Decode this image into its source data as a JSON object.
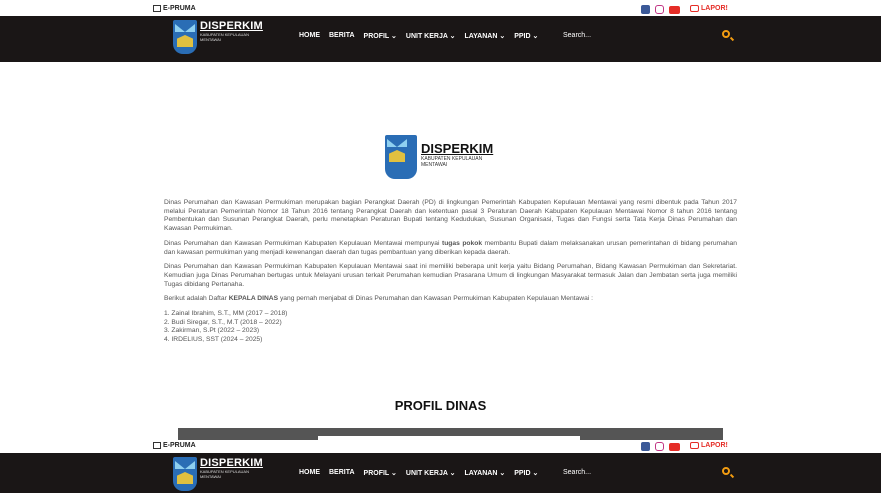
{
  "topbar": {
    "eprima": "E-PRUMA",
    "lapor": "LAPOR!"
  },
  "brand": {
    "name": "DISPERKIM",
    "sub_top": "KABUPATEN KEPULAUAN MENTAWAI",
    "sub_center": "KABUPATEN KEPULAUAN MENTAWAI"
  },
  "nav": {
    "items": [
      "HOME",
      "BERITA",
      "PROFIL ⌄",
      "UNIT KERJA ⌄",
      "LAYANAN ⌄",
      "PPID ⌄"
    ],
    "search_placeholder": "Search..."
  },
  "content": {
    "p1": "Dinas Perumahan dan Kawasan Permukiman merupakan bagian Perangkat Daerah (PD) di lingkungan Pemerintah Kabupaten Kepulauan Mentawai yang resmi dibentuk pada Tahun 2017 melalui Peraturan Pemerintah Nomor 18 Tahun 2016 tentang Perangkat Daerah dan ketentuan pasal 3 Peraturan Daerah Kabupaten Kepulauan Mentawai Nomor 8 tahun 2016 tentang Pembentukan dan Susunan Perangkat Daerah, perlu menetapkan Peraturan Bupati tentang Kedudukan, Susunan Organisasi, Tugas dan Fungsi serta Tata Kerja Dinas Perumahan dan Kawasan Permukiman.",
    "p2a": "Dinas Perumahan dan Kawasan Permukiman Kabupaten Kepulauan Mentawai mempunyai ",
    "p2b": "tugas pokok",
    "p2c": " membantu Bupati dalam melaksanakan urusan pemerintahan di bidang perumahan dan kawasan permukiman yang menjadi kewenangan daerah dan tugas pembantuan yang diberikan kepada daerah.",
    "p3": "Dinas Perumahan dan Kawasan Permukiman Kabupaten Kepulauan Mentawai saat ini memiliki beberapa unit kerja yaitu Bidang Perumahan, Bidang Kawasan Permukiman dan Sekretariat. Kemudian juga Dinas Perumahan bertugas untuk Melayani urusan terkait Perumahan kemudian Prasarana Umum di lingkungan Masyarakat termasuk Jalan dan Jembatan serta juga memiliki Tugas dibidang Pertanaha.",
    "p4a": "Berikut adalah Daftar ",
    "p4b": "KEPALA DINAS",
    "p4c": " yang pernah menjabat di Dinas Perumahan dan Kawasan Permukiman Kabupaten Kepulauan Mentawai :",
    "list": [
      "1. Zainal Ibrahim, S.T., MM (2017 – 2018)",
      "2. Budi Siregar, S.T., M.T (2018 – 2022)",
      "3. Zakirman, S.Pt (2022 – 2023)",
      "4. IRDELIUS, SST (2024 – 2025)"
    ],
    "heading": "PROFIL DINAS"
  }
}
